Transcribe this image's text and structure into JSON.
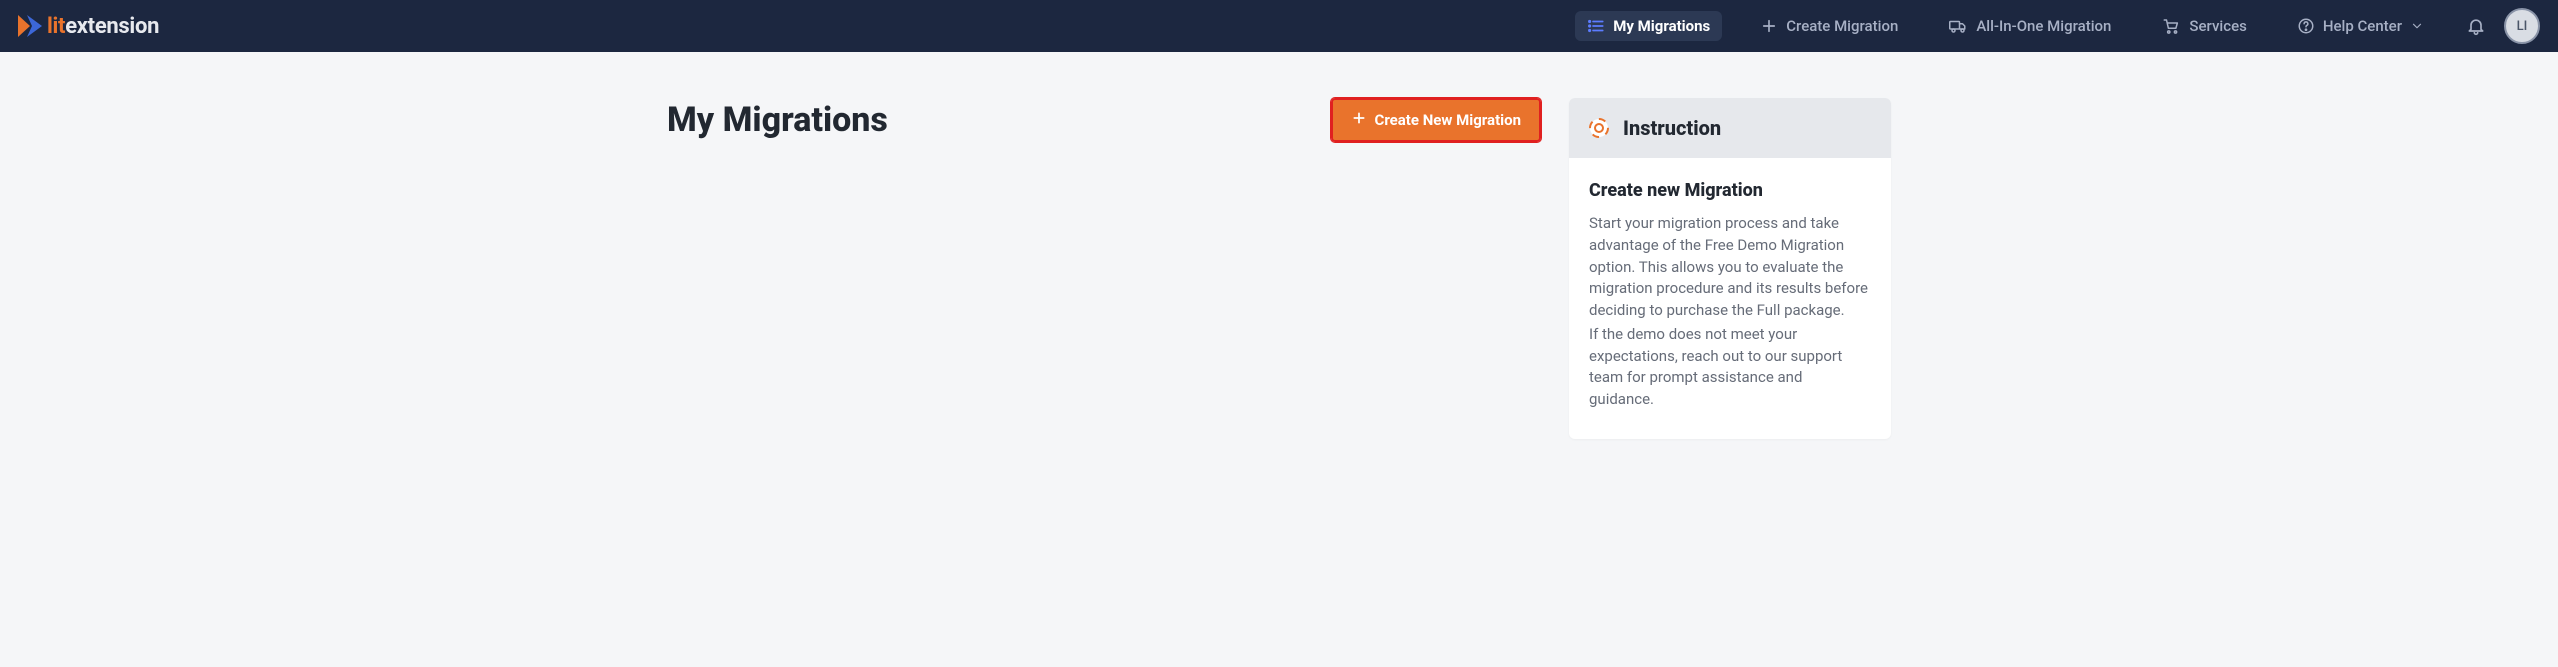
{
  "logo": {
    "lit": "lit",
    "ext": "extension"
  },
  "nav": {
    "my_migrations": "My Migrations",
    "create_migration": "Create Migration",
    "all_in_one": "All-In-One Migration",
    "services": "Services",
    "help_center": "Help Center"
  },
  "avatar_initials": "LI",
  "page": {
    "title": "My Migrations",
    "create_button": "Create New Migration"
  },
  "instruction": {
    "title": "Instruction",
    "subtitle": "Create new Migration",
    "p1": "Start your migration process and take advantage of the Free Demo Migration option. This allows you to evaluate the migration procedure and its results before deciding to purchase the Full package.",
    "p2": "If the demo does not meet your expectations, reach out to our support team for prompt assistance and guidance."
  }
}
